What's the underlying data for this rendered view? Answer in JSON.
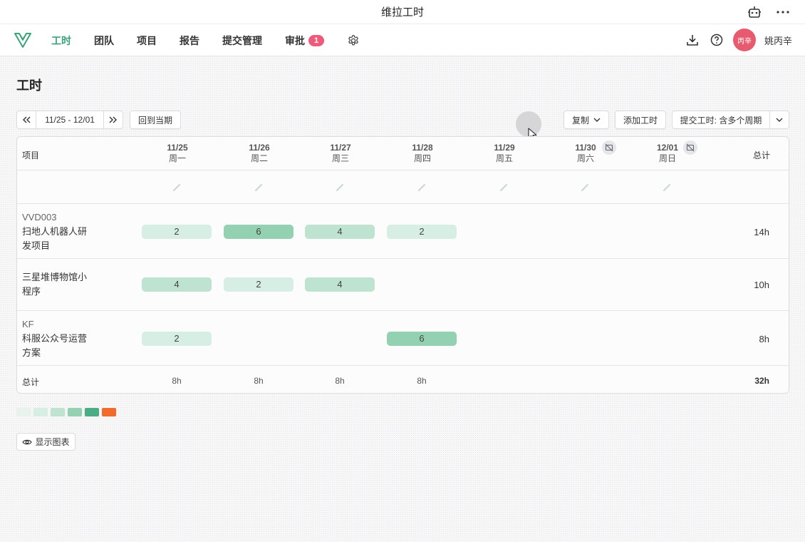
{
  "window": {
    "title": "维拉工时"
  },
  "nav": {
    "items": [
      {
        "label": "工时",
        "active": true
      },
      {
        "label": "团队"
      },
      {
        "label": "项目"
      },
      {
        "label": "报告"
      },
      {
        "label": "提交管理"
      },
      {
        "label": "审批",
        "badge": "1"
      }
    ],
    "user": {
      "avatar_text": "丙辛",
      "name": "姚丙辛"
    }
  },
  "page": {
    "title": "工时"
  },
  "toolbar": {
    "date_range": "11/25 - 12/01",
    "back_to_current": "回到当期",
    "copy": "复制",
    "add_time": "添加工时",
    "submit": "提交工时: 含多个周期"
  },
  "table": {
    "header_project": "项目",
    "header_total": "总计",
    "days": [
      {
        "date": "11/25",
        "weekday": "周一"
      },
      {
        "date": "11/26",
        "weekday": "周二"
      },
      {
        "date": "11/27",
        "weekday": "周三"
      },
      {
        "date": "11/28",
        "weekday": "周四"
      },
      {
        "date": "11/29",
        "weekday": "周五"
      },
      {
        "date": "11/30",
        "weekday": "周六",
        "icon": "no-timer-icon"
      },
      {
        "date": "12/01",
        "weekday": "周日",
        "icon": "no-timer-icon"
      }
    ],
    "rows": [
      {
        "code": "VVD003",
        "name_lines": [
          "扫地人机器人研",
          "发项目"
        ],
        "hours": [
          "2",
          "6",
          "4",
          "2",
          "",
          "",
          ""
        ],
        "total": "14h"
      },
      {
        "code": "",
        "name_lines": [
          "三星堆博物馆小",
          "程序"
        ],
        "hours": [
          "4",
          "2",
          "4",
          "",
          "",
          "",
          ""
        ],
        "total": "10h"
      },
      {
        "code": "KF",
        "name_lines": [
          "科服公众号运营",
          "方案"
        ],
        "hours": [
          "2",
          "",
          "",
          "6",
          "",
          "",
          ""
        ],
        "total": "8h"
      }
    ],
    "footer": {
      "label": "总计",
      "values": [
        "8h",
        "8h",
        "8h",
        "8h",
        "",
        "",
        ""
      ],
      "total": "32h"
    }
  },
  "legend_colors": [
    "#e8f3ee",
    "#d6eee3",
    "#bfe3d1",
    "#94d1b2",
    "#4aad84",
    "#f26b2a"
  ],
  "show_chart": "显示图表",
  "colors": {
    "accent": "#3aa37a",
    "badge": "#f05a7a",
    "avatar": "#e85a6e"
  }
}
